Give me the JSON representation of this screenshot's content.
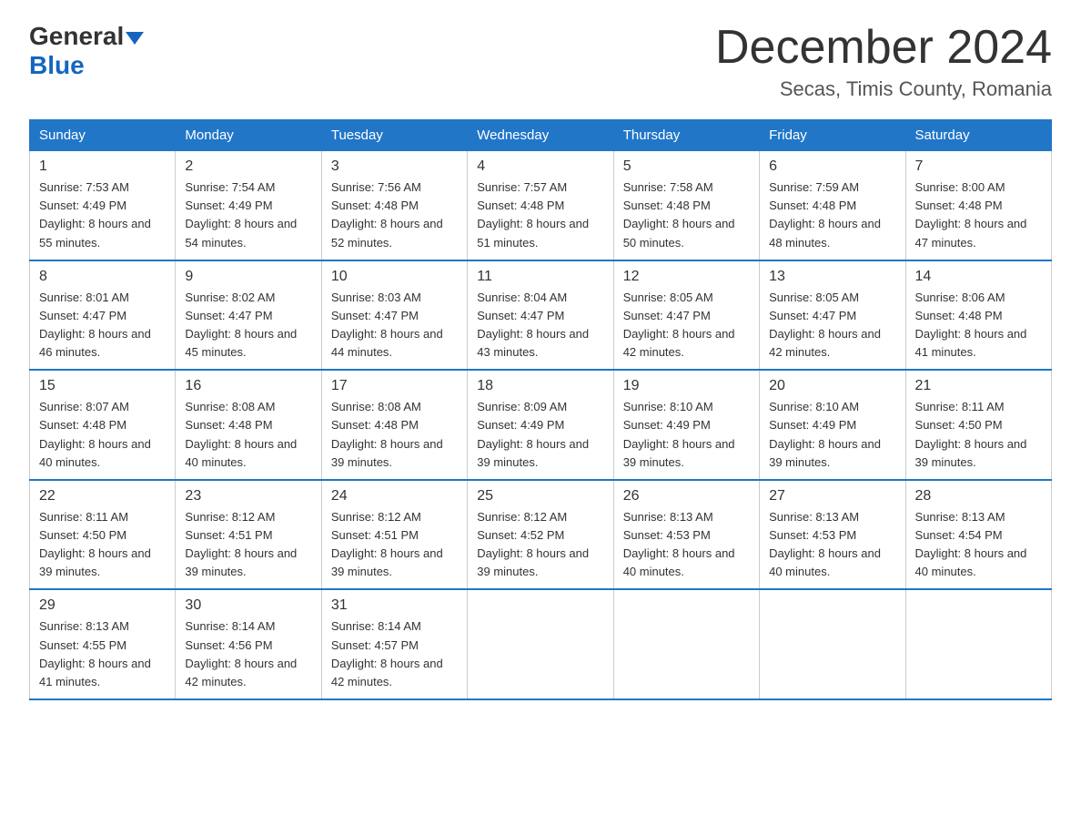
{
  "header": {
    "logo_general": "General",
    "logo_blue": "Blue",
    "month_title": "December 2024",
    "location": "Secas, Timis County, Romania"
  },
  "columns": [
    "Sunday",
    "Monday",
    "Tuesday",
    "Wednesday",
    "Thursday",
    "Friday",
    "Saturday"
  ],
  "weeks": [
    [
      {
        "day": "1",
        "sunrise": "Sunrise: 7:53 AM",
        "sunset": "Sunset: 4:49 PM",
        "daylight": "Daylight: 8 hours and 55 minutes."
      },
      {
        "day": "2",
        "sunrise": "Sunrise: 7:54 AM",
        "sunset": "Sunset: 4:49 PM",
        "daylight": "Daylight: 8 hours and 54 minutes."
      },
      {
        "day": "3",
        "sunrise": "Sunrise: 7:56 AM",
        "sunset": "Sunset: 4:48 PM",
        "daylight": "Daylight: 8 hours and 52 minutes."
      },
      {
        "day": "4",
        "sunrise": "Sunrise: 7:57 AM",
        "sunset": "Sunset: 4:48 PM",
        "daylight": "Daylight: 8 hours and 51 minutes."
      },
      {
        "day": "5",
        "sunrise": "Sunrise: 7:58 AM",
        "sunset": "Sunset: 4:48 PM",
        "daylight": "Daylight: 8 hours and 50 minutes."
      },
      {
        "day": "6",
        "sunrise": "Sunrise: 7:59 AM",
        "sunset": "Sunset: 4:48 PM",
        "daylight": "Daylight: 8 hours and 48 minutes."
      },
      {
        "day": "7",
        "sunrise": "Sunrise: 8:00 AM",
        "sunset": "Sunset: 4:48 PM",
        "daylight": "Daylight: 8 hours and 47 minutes."
      }
    ],
    [
      {
        "day": "8",
        "sunrise": "Sunrise: 8:01 AM",
        "sunset": "Sunset: 4:47 PM",
        "daylight": "Daylight: 8 hours and 46 minutes."
      },
      {
        "day": "9",
        "sunrise": "Sunrise: 8:02 AM",
        "sunset": "Sunset: 4:47 PM",
        "daylight": "Daylight: 8 hours and 45 minutes."
      },
      {
        "day": "10",
        "sunrise": "Sunrise: 8:03 AM",
        "sunset": "Sunset: 4:47 PM",
        "daylight": "Daylight: 8 hours and 44 minutes."
      },
      {
        "day": "11",
        "sunrise": "Sunrise: 8:04 AM",
        "sunset": "Sunset: 4:47 PM",
        "daylight": "Daylight: 8 hours and 43 minutes."
      },
      {
        "day": "12",
        "sunrise": "Sunrise: 8:05 AM",
        "sunset": "Sunset: 4:47 PM",
        "daylight": "Daylight: 8 hours and 42 minutes."
      },
      {
        "day": "13",
        "sunrise": "Sunrise: 8:05 AM",
        "sunset": "Sunset: 4:47 PM",
        "daylight": "Daylight: 8 hours and 42 minutes."
      },
      {
        "day": "14",
        "sunrise": "Sunrise: 8:06 AM",
        "sunset": "Sunset: 4:48 PM",
        "daylight": "Daylight: 8 hours and 41 minutes."
      }
    ],
    [
      {
        "day": "15",
        "sunrise": "Sunrise: 8:07 AM",
        "sunset": "Sunset: 4:48 PM",
        "daylight": "Daylight: 8 hours and 40 minutes."
      },
      {
        "day": "16",
        "sunrise": "Sunrise: 8:08 AM",
        "sunset": "Sunset: 4:48 PM",
        "daylight": "Daylight: 8 hours and 40 minutes."
      },
      {
        "day": "17",
        "sunrise": "Sunrise: 8:08 AM",
        "sunset": "Sunset: 4:48 PM",
        "daylight": "Daylight: 8 hours and 39 minutes."
      },
      {
        "day": "18",
        "sunrise": "Sunrise: 8:09 AM",
        "sunset": "Sunset: 4:49 PM",
        "daylight": "Daylight: 8 hours and 39 minutes."
      },
      {
        "day": "19",
        "sunrise": "Sunrise: 8:10 AM",
        "sunset": "Sunset: 4:49 PM",
        "daylight": "Daylight: 8 hours and 39 minutes."
      },
      {
        "day": "20",
        "sunrise": "Sunrise: 8:10 AM",
        "sunset": "Sunset: 4:49 PM",
        "daylight": "Daylight: 8 hours and 39 minutes."
      },
      {
        "day": "21",
        "sunrise": "Sunrise: 8:11 AM",
        "sunset": "Sunset: 4:50 PM",
        "daylight": "Daylight: 8 hours and 39 minutes."
      }
    ],
    [
      {
        "day": "22",
        "sunrise": "Sunrise: 8:11 AM",
        "sunset": "Sunset: 4:50 PM",
        "daylight": "Daylight: 8 hours and 39 minutes."
      },
      {
        "day": "23",
        "sunrise": "Sunrise: 8:12 AM",
        "sunset": "Sunset: 4:51 PM",
        "daylight": "Daylight: 8 hours and 39 minutes."
      },
      {
        "day": "24",
        "sunrise": "Sunrise: 8:12 AM",
        "sunset": "Sunset: 4:51 PM",
        "daylight": "Daylight: 8 hours and 39 minutes."
      },
      {
        "day": "25",
        "sunrise": "Sunrise: 8:12 AM",
        "sunset": "Sunset: 4:52 PM",
        "daylight": "Daylight: 8 hours and 39 minutes."
      },
      {
        "day": "26",
        "sunrise": "Sunrise: 8:13 AM",
        "sunset": "Sunset: 4:53 PM",
        "daylight": "Daylight: 8 hours and 40 minutes."
      },
      {
        "day": "27",
        "sunrise": "Sunrise: 8:13 AM",
        "sunset": "Sunset: 4:53 PM",
        "daylight": "Daylight: 8 hours and 40 minutes."
      },
      {
        "day": "28",
        "sunrise": "Sunrise: 8:13 AM",
        "sunset": "Sunset: 4:54 PM",
        "daylight": "Daylight: 8 hours and 40 minutes."
      }
    ],
    [
      {
        "day": "29",
        "sunrise": "Sunrise: 8:13 AM",
        "sunset": "Sunset: 4:55 PM",
        "daylight": "Daylight: 8 hours and 41 minutes."
      },
      {
        "day": "30",
        "sunrise": "Sunrise: 8:14 AM",
        "sunset": "Sunset: 4:56 PM",
        "daylight": "Daylight: 8 hours and 42 minutes."
      },
      {
        "day": "31",
        "sunrise": "Sunrise: 8:14 AM",
        "sunset": "Sunset: 4:57 PM",
        "daylight": "Daylight: 8 hours and 42 minutes."
      },
      null,
      null,
      null,
      null
    ]
  ]
}
